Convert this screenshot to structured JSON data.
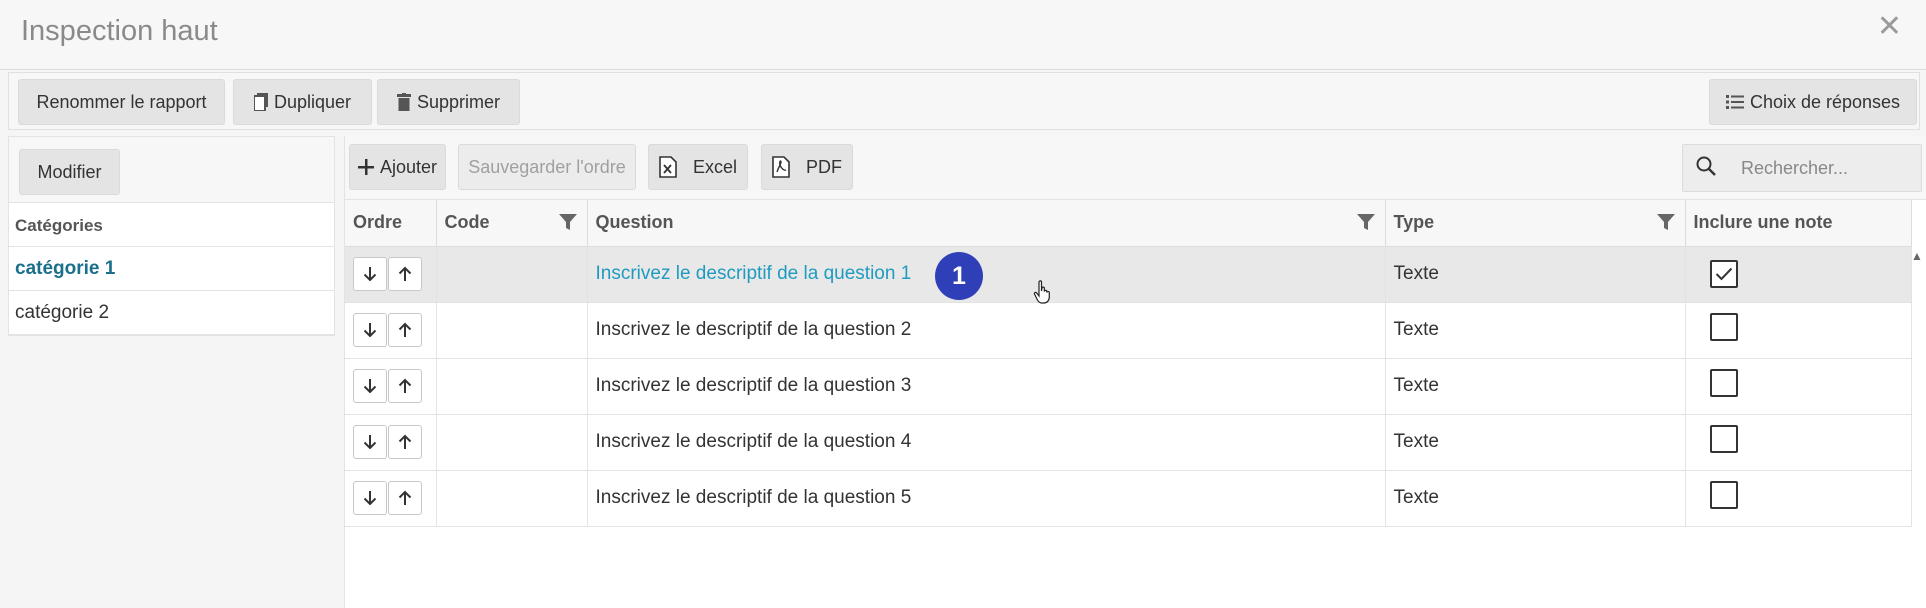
{
  "dialog": {
    "title": "Inspection haut",
    "close_icon": "close-icon"
  },
  "toolbar": {
    "rename_label": "Renommer le rapport",
    "duplicate_label": "Dupliquer",
    "delete_label": "Supprimer",
    "answers_label": "Choix de réponses"
  },
  "sidebar": {
    "modify_label": "Modifier",
    "header": "Catégories",
    "items": [
      {
        "label": "catégorie 1",
        "active": true
      },
      {
        "label": "catégorie 2",
        "active": false
      }
    ]
  },
  "main_toolbar": {
    "add_label": "Ajouter",
    "save_order_label": "Sauvegarder l'ordre",
    "excel_label": "Excel",
    "pdf_label": "PDF",
    "search_placeholder": "Rechercher..."
  },
  "table": {
    "columns": [
      "Ordre",
      "Code",
      "Question",
      "Type",
      "Inclure une note"
    ],
    "rows": [
      {
        "code": "",
        "question": "Inscrivez le descriptif de la question 1",
        "type": "Texte",
        "note": true,
        "selected": true
      },
      {
        "code": "",
        "question": "Inscrivez le descriptif de la question 2",
        "type": "Texte",
        "note": false,
        "selected": false
      },
      {
        "code": "",
        "question": "Inscrivez le descriptif de la question 3",
        "type": "Texte",
        "note": false,
        "selected": false
      },
      {
        "code": "",
        "question": "Inscrivez le descriptif de la question 4",
        "type": "Texte",
        "note": false,
        "selected": false
      },
      {
        "code": "",
        "question": "Inscrivez le descriptif de la question 5",
        "type": "Texte",
        "note": false,
        "selected": false
      }
    ]
  },
  "annotation": {
    "step_badge": "1"
  },
  "colors": {
    "accent_link": "#1f9bc0",
    "active_category": "#1a6f8a",
    "badge": "#2f3fb8"
  }
}
